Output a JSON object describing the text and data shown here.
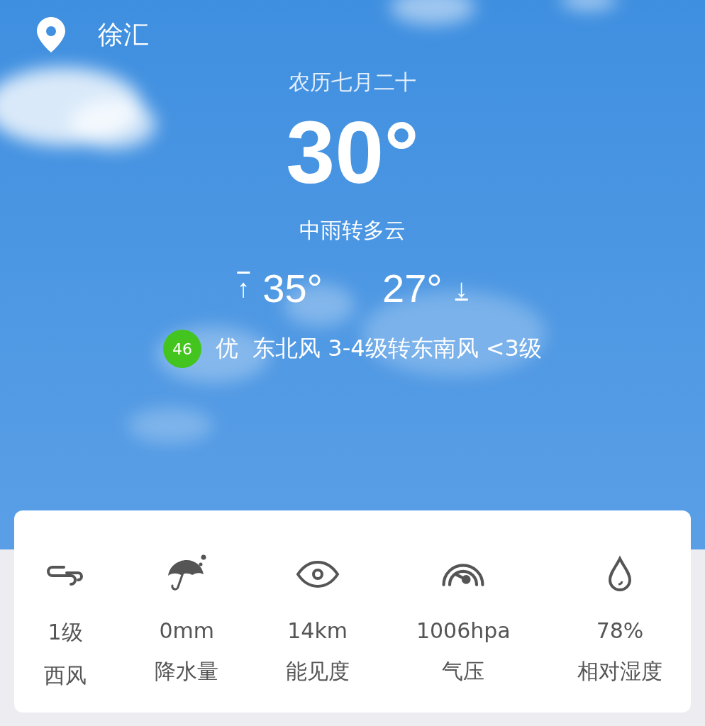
{
  "location": {
    "name": "徐汇"
  },
  "lunar_date": "农历七月二十",
  "temperature": "30°",
  "condition": "中雨转多云",
  "high": {
    "arrow": "↑",
    "value": "35°"
  },
  "low": {
    "value": "27°",
    "arrow": "↓"
  },
  "air_quality": {
    "index": "46",
    "color": "#44c41f",
    "label": "优"
  },
  "wind_forecast": "东北风 3-4级转东南风 <3级",
  "stats": [
    {
      "kind": "wind",
      "value": "1级",
      "label": "西风"
    },
    {
      "kind": "rain",
      "value": "0mm",
      "label": "降水量"
    },
    {
      "kind": "visibility",
      "value": "14km",
      "label": "能见度"
    },
    {
      "kind": "pressure",
      "value": "1006hpa",
      "label": "气压"
    },
    {
      "kind": "humidity",
      "value": "78%",
      "label": "相对湿度"
    }
  ]
}
